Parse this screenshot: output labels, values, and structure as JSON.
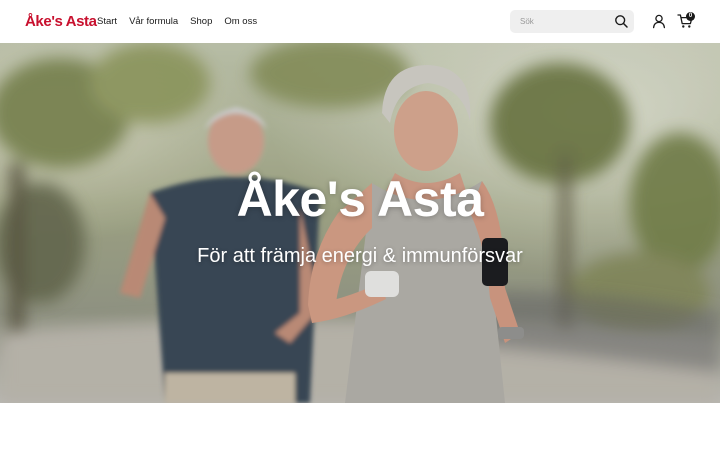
{
  "header": {
    "logo": "Åke's Asta",
    "nav": [
      {
        "label": "Start"
      },
      {
        "label": "Vår formula"
      },
      {
        "label": "Shop"
      },
      {
        "label": "Om oss"
      }
    ],
    "search": {
      "placeholder": "Sök",
      "icon": "search-icon"
    },
    "account_icon": "user-icon",
    "cart": {
      "icon": "cart-icon",
      "count": "0"
    }
  },
  "hero": {
    "title": "Åke's Asta",
    "subtitle": "För att främja energi & immunförsvar",
    "image": "photo of two older people jogging outdoors in a park"
  },
  "colors": {
    "brand": "#c8102e",
    "text": "#1a1a1a",
    "search_bg": "#efefef"
  }
}
